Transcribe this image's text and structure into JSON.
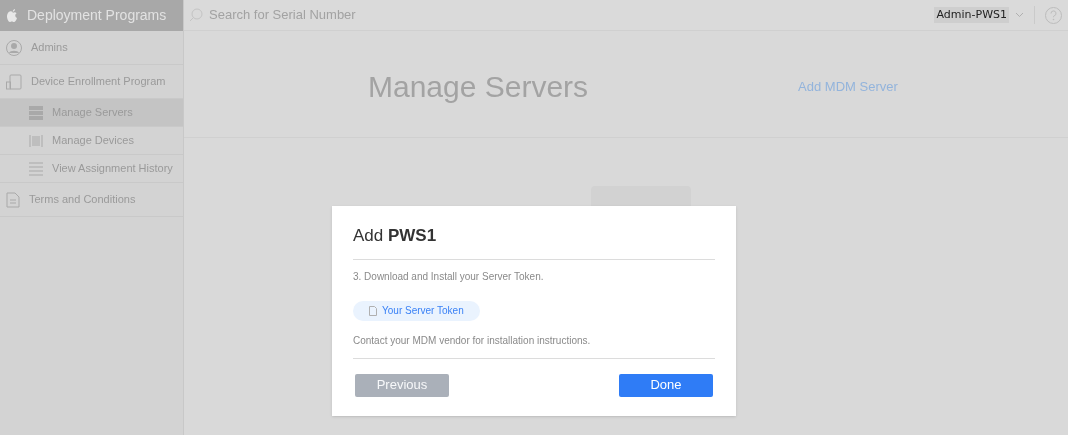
{
  "sidebar": {
    "title": "Deployment Programs",
    "items": [
      {
        "kind": "admins",
        "label": "Admins",
        "selected": false
      },
      {
        "kind": "device",
        "label": "Device Enrollment Program",
        "selected": false,
        "children": [
          {
            "kind": "servers",
            "label": "Manage Servers",
            "selected": true
          },
          {
            "kind": "devices",
            "label": "Manage Devices",
            "selected": false
          },
          {
            "kind": "history",
            "label": "View Assignment History",
            "selected": false
          }
        ]
      },
      {
        "kind": "terms",
        "label": "Terms and Conditions",
        "selected": false
      }
    ]
  },
  "header": {
    "search": {
      "placeholder": "Search for Serial Number"
    },
    "account": "Admin-PWS1"
  },
  "main": {
    "title": "Manage Servers",
    "action": "Add MDM Server"
  },
  "dialog": {
    "title": "Add **PWS1**",
    "step": "3. Download and Install your Server Token.",
    "token_button": "Your Server Token",
    "note": "Contact your MDM vendor for installation instructions.",
    "buttons": [
      {
        "label": "Previous",
        "kind": "secondary",
        "disabled": true
      },
      {
        "label": "Done",
        "kind": "primary",
        "disabled": false
      }
    ]
  }
}
